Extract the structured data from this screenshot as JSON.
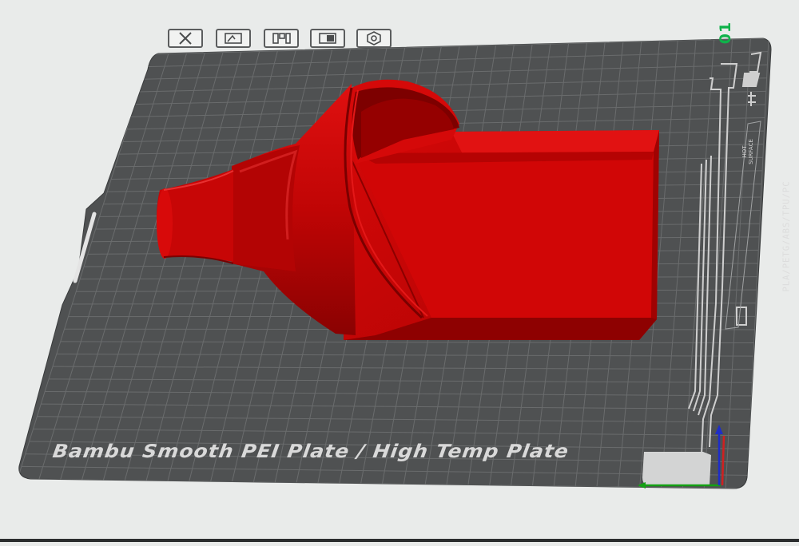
{
  "plate": {
    "number": "01",
    "label": "Bambu Smooth PEI Plate / High Temp Plate",
    "materials": "PLA/PETG/ABS/TPU/PC",
    "hot_surface": [
      "HOT",
      "SURFACE"
    ]
  },
  "plate_toolbar": [
    {
      "name": "remove-plate-button",
      "icon": "x-box-icon"
    },
    {
      "name": "pick-objects-button",
      "icon": "pick-icon"
    },
    {
      "name": "arrange-button",
      "icon": "arrange-icon"
    },
    {
      "name": "orient-button",
      "icon": "orient-icon"
    },
    {
      "name": "plate-settings-button",
      "icon": "hex-nut-icon"
    }
  ],
  "colors": {
    "background": "#e9ebea",
    "plate": "#4f5152",
    "grid": "#6a6c6d",
    "model": "#c20403",
    "plate_number": "#0fb24a",
    "axis_x": "#14a014",
    "axis_y": "#d02020",
    "axis_z": "#1e2ec8"
  }
}
